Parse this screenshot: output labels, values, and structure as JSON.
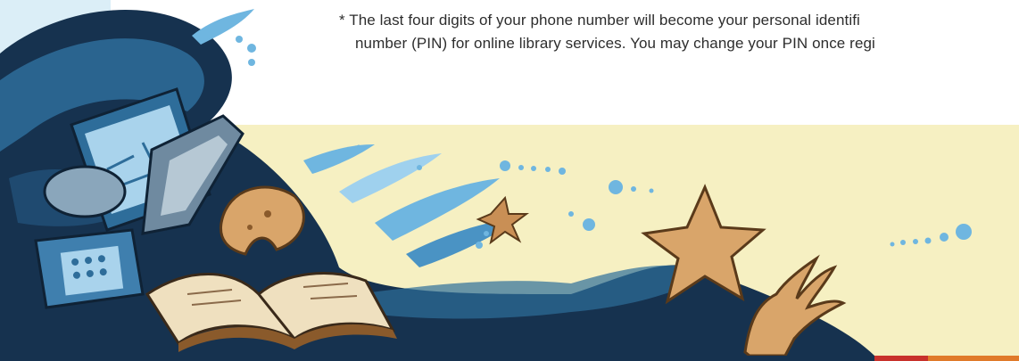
{
  "notice": {
    "pin_line_1": "* The last four digits of your phone number will become your personal identifi",
    "pin_line_2": "number (PIN) for online library services. You may change your PIN once regi"
  },
  "illustration": {
    "elements": [
      "wave-swoosh",
      "computer-monitor-icon",
      "keyboard-icon",
      "calculator-phone-icon",
      "open-book-icon",
      "bagel-cookie-icon",
      "starfish-icon",
      "hand-icon",
      "bubbles"
    ]
  },
  "colors": {
    "paper_yellow": "#f6f0c2",
    "wave_dark": "#16324f",
    "wave_mid": "#2e6d9a",
    "wave_light": "#6fb6e0",
    "sand_star": "#d9a56a",
    "sand_dark": "#8a5a2b",
    "text": "#2d2d2d",
    "stripe_red": "#c8312b",
    "stripe_orange": "#e07a2a"
  }
}
